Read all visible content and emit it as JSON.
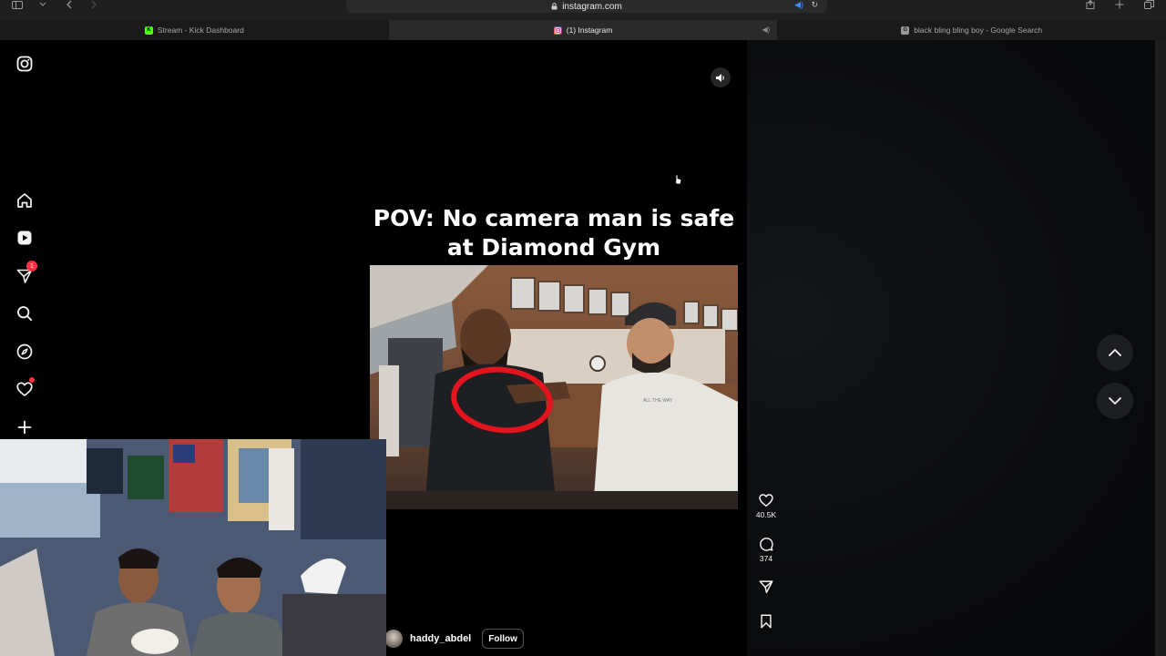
{
  "browser": {
    "url": "instagram.com",
    "tabs": [
      {
        "label": "Stream - Kick Dashboard",
        "favicon": "kick-icon",
        "color": "#53fc18"
      },
      {
        "label": "(1) Instagram",
        "favicon": "instagram-icon",
        "color": "#e1306c",
        "active": true
      },
      {
        "label": "black bling bling boy - Google Search",
        "favicon": "google-icon",
        "color": "#9a9a9a"
      }
    ]
  },
  "sidebar": {
    "items": [
      {
        "name": "instagram-logo-icon"
      },
      {
        "name": "home-icon"
      },
      {
        "name": "reels-icon"
      },
      {
        "name": "messages-icon",
        "badge": "1"
      },
      {
        "name": "search-icon"
      },
      {
        "name": "explore-icon"
      },
      {
        "name": "notifications-icon"
      },
      {
        "name": "create-icon"
      }
    ]
  },
  "reel": {
    "title_line1": "POV: No camera man is safe",
    "title_line2": "at Diamond Gym",
    "author": "haddy_abdel",
    "follow_label": "Follow"
  },
  "actions": {
    "likes": "40.5K",
    "comments": "374"
  },
  "colors": {
    "accent_red": "#ff3040",
    "background": "#000000"
  }
}
